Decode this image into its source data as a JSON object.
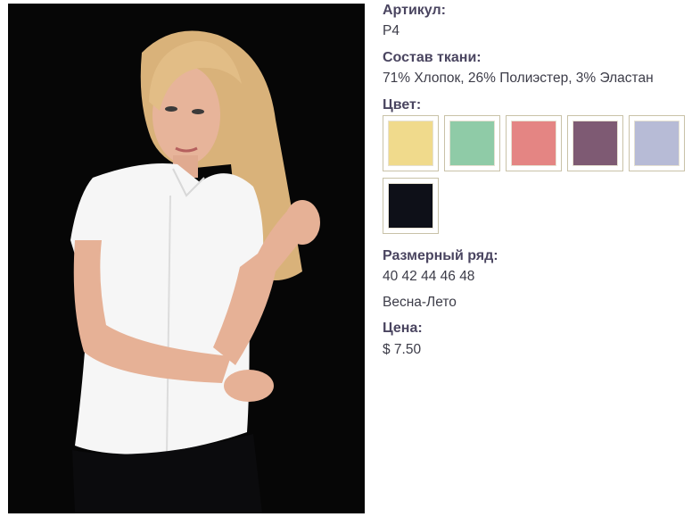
{
  "product": {
    "article_label": "Артикул:",
    "article_value": "P4",
    "fabric_label": "Состав ткани:",
    "fabric_value": "71% Хлопок, 26% Полиэстер, 3% Эластан",
    "color_label": "Цвет:",
    "colors": [
      {
        "name": "yellow",
        "hex": "#f0da8c"
      },
      {
        "name": "mint",
        "hex": "#8fcba7"
      },
      {
        "name": "pink",
        "hex": "#e48583"
      },
      {
        "name": "plum",
        "hex": "#7e5a73"
      },
      {
        "name": "lavender",
        "hex": "#b7bbd6"
      },
      {
        "name": "black",
        "hex": "#0e1018"
      }
    ],
    "sizes_label": "Размерный ряд:",
    "sizes_value": "40 42 44 46 48",
    "season_value": "Весна-Лето",
    "price_label": "Цена:",
    "price_value": "$ 7.50"
  }
}
